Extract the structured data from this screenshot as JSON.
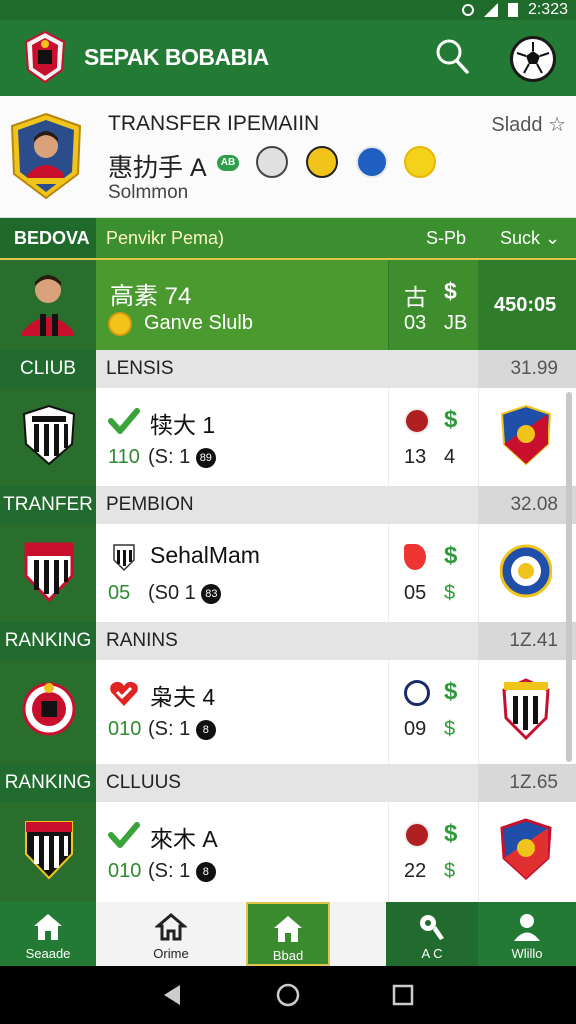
{
  "status_bar": {
    "time": "2:323"
  },
  "app": {
    "title": "SEPAK BOBABIA"
  },
  "transfer": {
    "title": "TRANSFER IPEMAIIN",
    "slad": "Sladd ☆",
    "player_name": "惠扐手 A",
    "tag": "AB",
    "subtitle": "Solmmon"
  },
  "tabs": {
    "active": "BEDOVA",
    "middle": "Penvikr Pema)",
    "right1": "S-Pb",
    "right2": "Suck ⌄"
  },
  "featured": {
    "name": "高素  74",
    "club": "Ganve Slulb",
    "top_left": "古",
    "top_right": "$",
    "bottom_left": "03",
    "bottom_right": "JB",
    "time": "450:05"
  },
  "sections": [
    {
      "label": "CLIUB",
      "title": "LENSIS",
      "value": "31.99",
      "row": {
        "name": "犊大 1",
        "n1": "110",
        "n2": "(S: 1",
        "dot": "89",
        "c1": "13",
        "c2": "4",
        "dollar": "$",
        "mark": "check",
        "mark_color": "#3aa33a"
      }
    },
    {
      "label": "TRANFER",
      "title": "PEMBION",
      "value": "32.08",
      "row": {
        "name": "SehalMam",
        "n1": "05",
        "n2": "(S0 1",
        "dot": "83",
        "c1": "05",
        "c2": "$",
        "dollar": "$",
        "mark": "crest",
        "mark_color": "#333333"
      }
    },
    {
      "label": "RANKING",
      "title": "RANINS",
      "value": "1Z.41",
      "row": {
        "name": "枭夫 4",
        "n1": "010",
        "n2": "(S: 1",
        "dot": "8",
        "c1": "09",
        "c2": "$",
        "dollar": "$",
        "mark": "heart-check",
        "mark_color": "#e02424"
      }
    },
    {
      "label": "RANKING",
      "title": "CLLUUS",
      "value": "1Z.65",
      "row": {
        "name": "來木 A",
        "n1": "010",
        "n2": "(S: 1",
        "dot": "8",
        "c1": "22",
        "c2": "$",
        "dollar": "$",
        "mark": "check",
        "mark_color": "#3aa33a"
      }
    }
  ],
  "bottom_nav": [
    {
      "label": "Seaade",
      "icon": "home-icon"
    },
    {
      "label": "Orime",
      "icon": "home-outline-icon"
    },
    {
      "label": "Bbad",
      "icon": "home-icon"
    },
    {
      "label": "A C",
      "icon": "soccer-person-icon"
    },
    {
      "label": "Wlillo",
      "icon": "person-icon"
    }
  ],
  "colors": {
    "primary": "#237a34",
    "accent": "#e3c44a",
    "money": "#2e9a3a"
  }
}
